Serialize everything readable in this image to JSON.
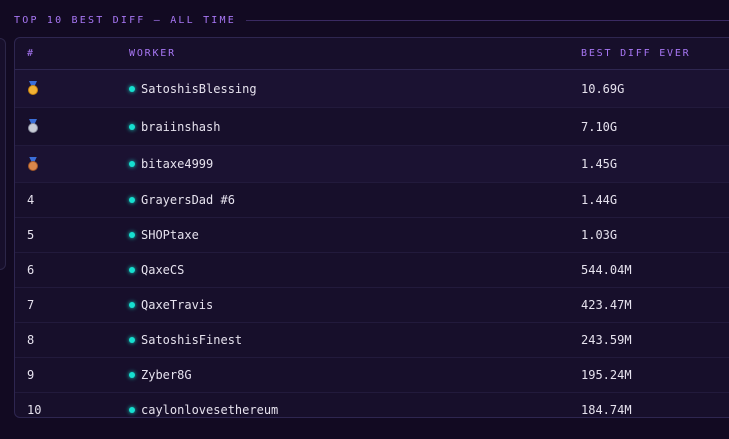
{
  "section": {
    "title": "TOP 10 BEST DIFF — ALL TIME"
  },
  "table": {
    "headers": {
      "rank": "#",
      "worker": "WORKER",
      "diff": "BEST DIFF EVER"
    },
    "rows": [
      {
        "rank": "",
        "medal": "gold-medal-icon",
        "worker": "SatoshisBlessing",
        "diff": "10.69G"
      },
      {
        "rank": "",
        "medal": "silver-medal-icon",
        "worker": "braiinshash",
        "diff": "7.10G"
      },
      {
        "rank": "",
        "medal": "bronze-medal-icon",
        "worker": "bitaxe4999",
        "diff": "1.45G"
      },
      {
        "rank": "4",
        "worker": "GrayersDad #6",
        "diff": "1.44G"
      },
      {
        "rank": "5",
        "worker": "SHOPtaxe",
        "diff": "1.03G"
      },
      {
        "rank": "6",
        "worker": "QaxeCS",
        "diff": "544.04M"
      },
      {
        "rank": "7",
        "worker": "QaxeTravis",
        "diff": "423.47M"
      },
      {
        "rank": "8",
        "worker": "SatoshisFinest",
        "diff": "243.59M"
      },
      {
        "rank": "9",
        "worker": "Zyber8G",
        "diff": "195.24M"
      },
      {
        "rank": "10",
        "worker": "caylonlovesethereum",
        "diff": "184.74M"
      }
    ]
  },
  "colors": {
    "accent": "#a877f5",
    "online_dot": "#16e0d0",
    "background": "#120a22",
    "panel": "#170f2b"
  }
}
